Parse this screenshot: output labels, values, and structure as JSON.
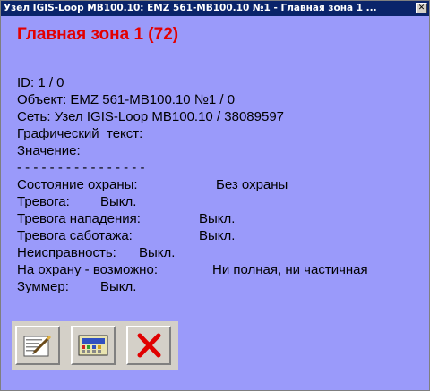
{
  "window": {
    "title": "Узел IGIS-Loop MB100.10: EMZ 561-MB100.10 №1 - Главная зона 1 ...",
    "close_glyph": "✕"
  },
  "heading": "Главная зона 1 (72)",
  "info": {
    "id": "ID: 1 / 0",
    "object": "Объект: EMZ 561-MB100.10 №1 / 0",
    "network": "Сеть: Узел IGIS-Loop MB100.10 / 38089597",
    "graphic_text": "Графический_текст:",
    "value": "Значение:",
    "separator": "- - - - - - - - - - - - - - - -"
  },
  "status": {
    "guard_label": "Состояние охраны:",
    "guard_value": "Без охраны",
    "alarm_label": "Тревога:",
    "alarm_value": "Выкл.",
    "attack_label": "Тревога нападения:",
    "attack_value": "Выкл.",
    "sabotage_label": "Тревога саботажа:",
    "sabotage_value": "Выкл.",
    "fault_label": "Неисправность:",
    "fault_value": "Выкл.",
    "arm_label": "На охрану - возможно:",
    "arm_value": "Ни полная, ни частичная",
    "buzzer_label": "Зуммер:",
    "buzzer_value": "Выкл."
  },
  "toolbar": {
    "buttons": [
      {
        "icon": "edit-document-icon"
      },
      {
        "icon": "control-panel-icon"
      },
      {
        "icon": "close-red-x-icon"
      }
    ]
  },
  "colors": {
    "background": "#9a9afa",
    "heading": "#e30000",
    "titlebar": "#0a246a"
  }
}
